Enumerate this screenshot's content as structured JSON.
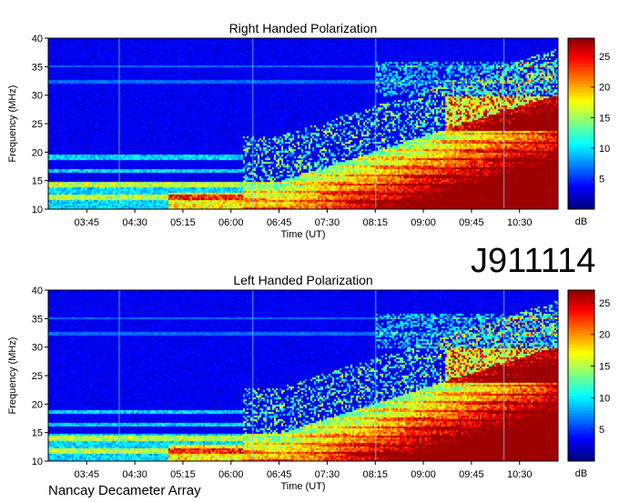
{
  "figure": {
    "id_label": "J911114",
    "footer": "Nancay Decameter Array"
  },
  "chart_data": [
    {
      "type": "heatmap",
      "title": "Right Handed Polarization",
      "xlabel": "Time (UT)",
      "ylabel": "Frequency (MHz)",
      "x_ticks": [
        "03:45",
        "04:30",
        "05:15",
        "06:00",
        "06:45",
        "07:30",
        "08:15",
        "09:00",
        "09:45",
        "10:30"
      ],
      "x_range": [
        "03:09",
        "11:06"
      ],
      "y_ticks": [
        10,
        15,
        20,
        25,
        30,
        35,
        40
      ],
      "ylim": [
        10,
        40
      ],
      "colorbar": {
        "label": "dB",
        "ticks": [
          5,
          10,
          15,
          20,
          25
        ],
        "range": [
          0,
          28
        ],
        "colormap": "jet"
      },
      "grid": false
    },
    {
      "type": "heatmap",
      "title": "Left Handed Polarization",
      "xlabel": "Time (UT)",
      "ylabel": "Frequency (MHz)",
      "x_ticks": [
        "03:45",
        "04:30",
        "05:15",
        "06:00",
        "06:45",
        "07:30",
        "08:15",
        "09:00",
        "09:45",
        "10:30"
      ],
      "x_range": [
        "03:09",
        "11:06"
      ],
      "y_ticks": [
        10,
        15,
        20,
        25,
        30,
        35,
        40
      ],
      "ylim": [
        10,
        40
      ],
      "colorbar": {
        "label": "dB",
        "ticks": [
          5,
          10,
          15,
          20,
          25
        ],
        "range": [
          0,
          27
        ],
        "colormap": "jet"
      },
      "grid": false
    }
  ]
}
